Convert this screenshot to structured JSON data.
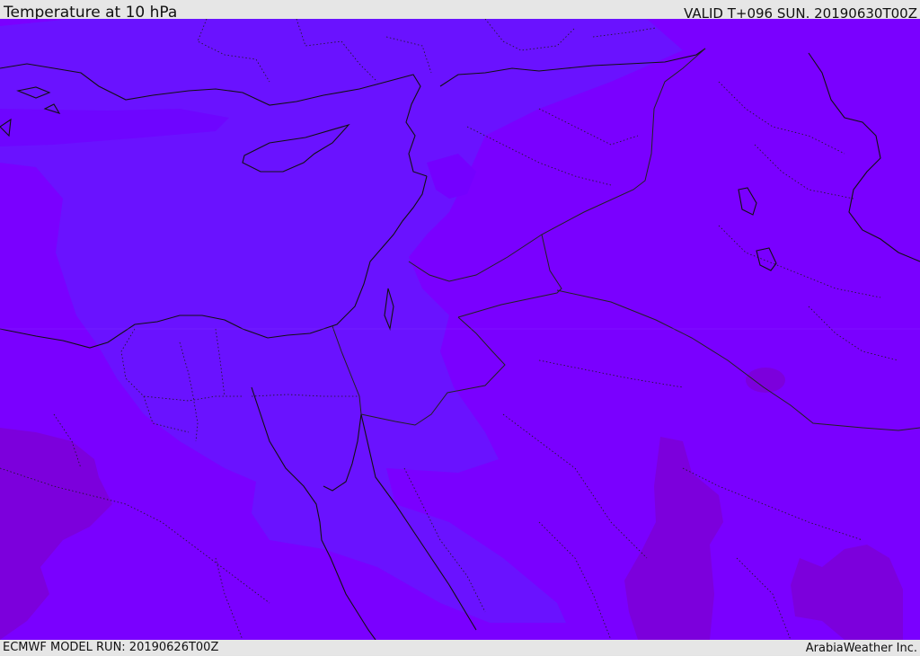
{
  "header": {
    "title": "Temperature at 10 hPa",
    "valid": "VALID T+096 SUN. 20190630T00Z"
  },
  "footer": {
    "model_run": "ECMWF MODEL RUN: 20190626T00Z",
    "credit": "ArabiaWeather Inc."
  },
  "map": {
    "colors": {
      "background": "#7a00ff",
      "cool_band": "#6a12ff",
      "warm_patch": "#8000e8",
      "dark_patch": "#7c00dc",
      "coastline": "#111111",
      "border": "#222222"
    }
  }
}
